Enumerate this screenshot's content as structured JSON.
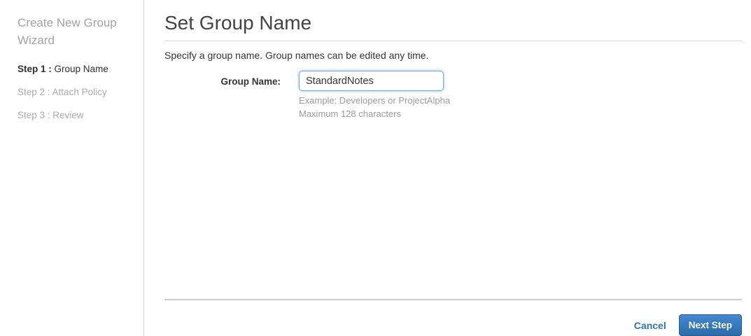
{
  "sidebar": {
    "title": "Create New Group Wizard",
    "steps": [
      {
        "prefix": "Step 1 :",
        "label": " Group Name",
        "active": true
      },
      {
        "prefix": "Step 2 :",
        "label": " Attach Policy",
        "active": false
      },
      {
        "prefix": "Step 3 :",
        "label": " Review",
        "active": false
      }
    ]
  },
  "main": {
    "title": "Set Group Name",
    "subtitle": "Specify a group name. Group names can be edited any time.",
    "form": {
      "label": "Group Name:",
      "value": "StandardNotes",
      "hint_line1": "Example: Developers or ProjectAlpha",
      "hint_line2": "Maximum 128 characters"
    },
    "footer": {
      "cancel_label": "Cancel",
      "next_label": "Next Step"
    }
  },
  "colors": {
    "link_blue": "#2d72b8",
    "button_gradient_top": "#4489d3",
    "button_gradient_bottom": "#2c6ba7",
    "input_focus_border": "#6fa7d9",
    "muted_text": "#9b9b9b",
    "sidebar_title_gray": "#a2a2a2"
  }
}
